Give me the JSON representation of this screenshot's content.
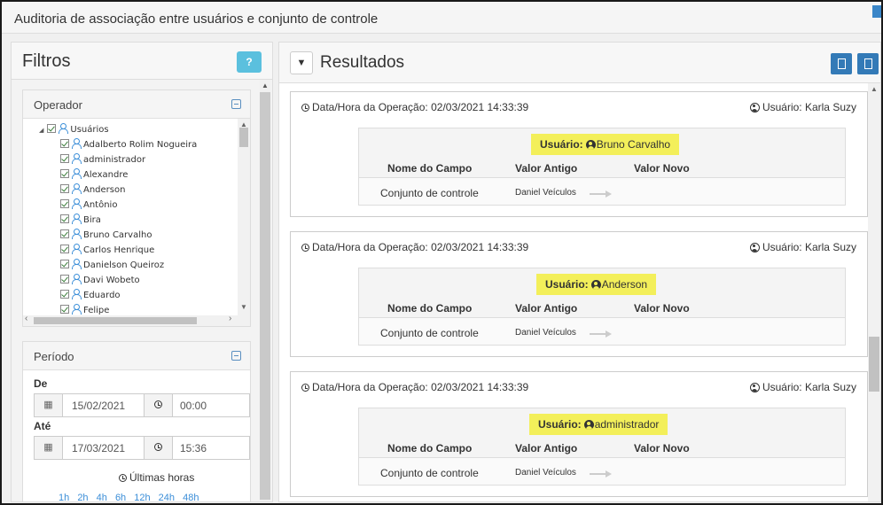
{
  "window": {
    "title": "Auditoria de associação entre usuários e conjunto de controle"
  },
  "filters": {
    "title": "Filtros",
    "help_label": "?",
    "operador": {
      "title": "Operador",
      "root": "Usuários",
      "users": [
        "Adalberto Rolim Nogueira",
        "administrador",
        "Alexandre",
        "Anderson",
        "Antônio",
        "Bira",
        "Bruno Carvalho",
        "Carlos Henrique",
        "Danielson Queiroz",
        "Davi Wobeto",
        "Eduardo",
        "Felipe"
      ]
    },
    "periodo": {
      "title": "Período",
      "de_label": "De",
      "de_date": "15/02/2021",
      "de_time": "00:00",
      "ate_label": "Até",
      "ate_date": "17/03/2021",
      "ate_time": "15:36",
      "ultimas_label": "Últimas horas",
      "hours": [
        "1h",
        "2h",
        "4h",
        "6h",
        "12h",
        "24h",
        "48h"
      ]
    }
  },
  "results": {
    "title": "Resultados",
    "cards": [
      {
        "op_label": "Data/Hora da Operação:",
        "op_datetime": "02/03/2021 14:33:39",
        "user_label": "Usuário:",
        "user_name": "Karla Suzy",
        "hl_label": "Usuário:",
        "hl_user": "Bruno Carvalho",
        "col_campo": "Nome do Campo",
        "col_antigo": "Valor Antigo",
        "col_novo": "Valor Novo",
        "campo": "Conjunto de controle",
        "antigo": "Daniel Veículos",
        "novo": ""
      },
      {
        "op_label": "Data/Hora da Operação:",
        "op_datetime": "02/03/2021 14:33:39",
        "user_label": "Usuário:",
        "user_name": "Karla Suzy",
        "hl_label": "Usuário:",
        "hl_user": "Anderson",
        "col_campo": "Nome do Campo",
        "col_antigo": "Valor Antigo",
        "col_novo": "Valor Novo",
        "campo": "Conjunto de controle",
        "antigo": "Daniel Veículos",
        "novo": ""
      },
      {
        "op_label": "Data/Hora da Operação:",
        "op_datetime": "02/03/2021 14:33:39",
        "user_label": "Usuário:",
        "user_name": "Karla Suzy",
        "hl_label": "Usuário:",
        "hl_user": "administrador",
        "col_campo": "Nome do Campo",
        "col_antigo": "Valor Antigo",
        "col_novo": "Valor Novo",
        "campo": "Conjunto de controle",
        "antigo": "Daniel Veículos",
        "novo": ""
      }
    ]
  },
  "colors": {
    "accent": "#337ab7",
    "info": "#5bc0de",
    "highlight": "#f3ef5a",
    "link": "#3b8ed8"
  }
}
